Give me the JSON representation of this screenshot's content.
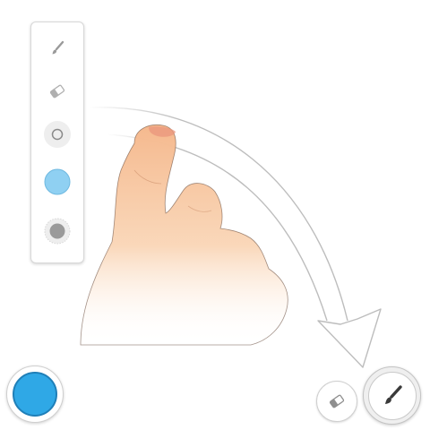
{
  "toolbar": {
    "tools": [
      {
        "name": "brush",
        "icon": "brush-icon"
      },
      {
        "name": "eraser",
        "icon": "eraser-icon"
      },
      {
        "name": "size-small",
        "icon": "circle-outline-icon"
      },
      {
        "name": "color",
        "icon": "color-swatch"
      },
      {
        "name": "size-large",
        "icon": "filled-circle-icon"
      }
    ],
    "selected_color": "#8fd0f2"
  },
  "bottom_controls": {
    "color_button_color": "#2fa8e6",
    "eraser_icon": "eraser-icon",
    "brush_icon": "brush-icon"
  },
  "illustration": {
    "gesture": "swipe-down-arc-arrow",
    "hand_color": "#f7c9a1"
  }
}
